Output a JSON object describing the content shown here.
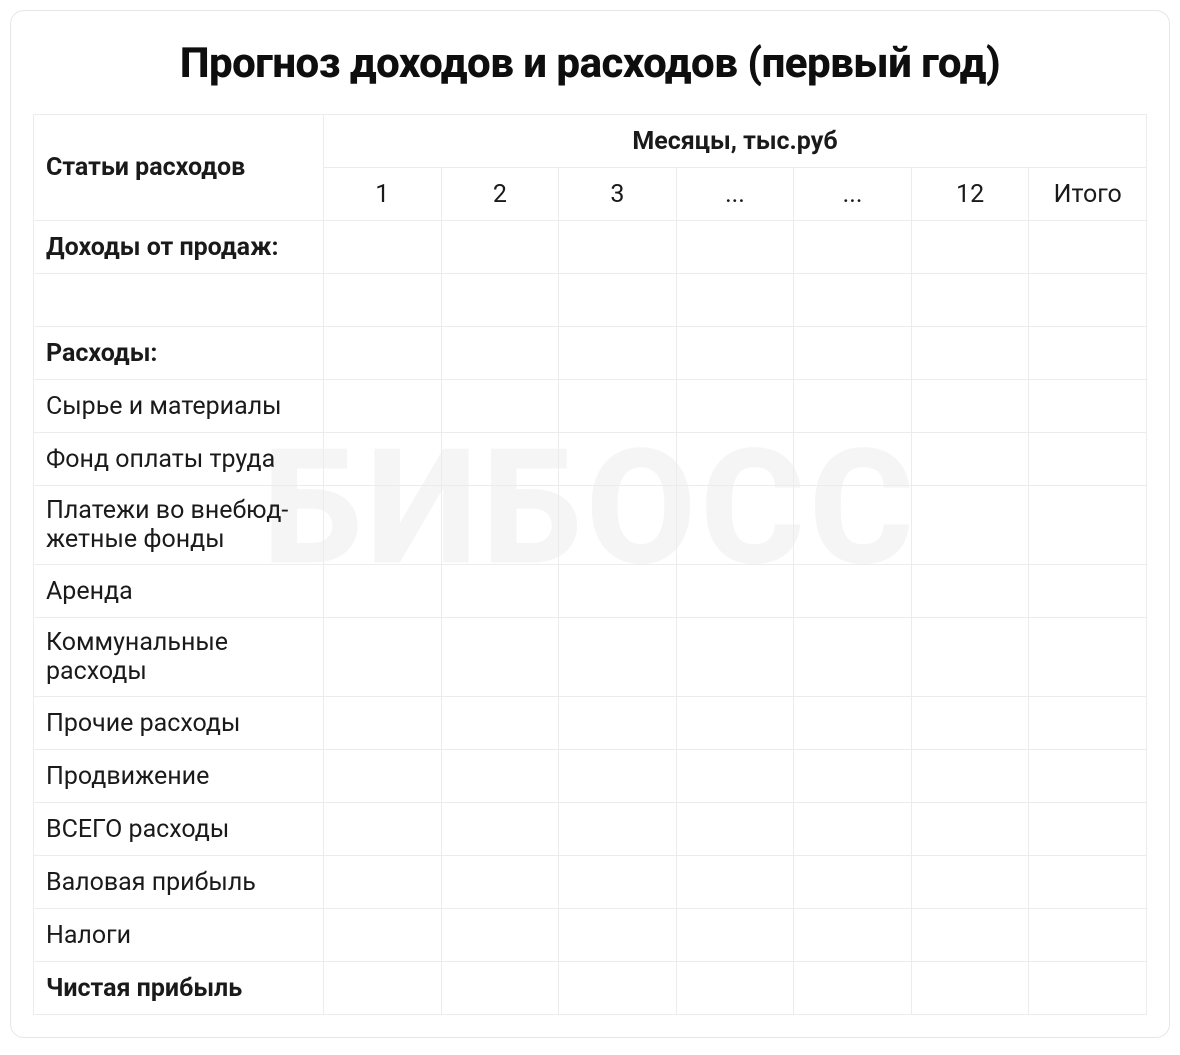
{
  "watermark": "БИБОСС",
  "title": "Прогноз доходов и расходов (первый год)",
  "headers": {
    "rowHeader": "Статьи расходов",
    "monthsGroup": "Месяцы, тыс.руб",
    "cols": [
      "1",
      "2",
      "3",
      "...",
      "...",
      "12",
      "Итого"
    ]
  },
  "rows": [
    {
      "label": "Доходы от продаж:",
      "bold": true
    },
    {
      "label": "",
      "bold": false
    },
    {
      "label": "Расходы:",
      "bold": true
    },
    {
      "label": "Сырье и материалы",
      "bold": false
    },
    {
      "label": "Фонд оплаты труда",
      "bold": false
    },
    {
      "label": "Платежи во внебюд­жетные фонды",
      "bold": false
    },
    {
      "label": "Аренда",
      "bold": false
    },
    {
      "label": "Коммунальные расходы",
      "bold": false
    },
    {
      "label": "Прочие расходы",
      "bold": false
    },
    {
      "label": "Продвижение",
      "bold": false
    },
    {
      "label": "ВСЕГО расходы",
      "bold": false
    },
    {
      "label": "Валовая прибыль",
      "bold": false
    },
    {
      "label": "Налоги",
      "bold": false
    },
    {
      "label": "Чистая прибыль",
      "bold": true
    }
  ]
}
